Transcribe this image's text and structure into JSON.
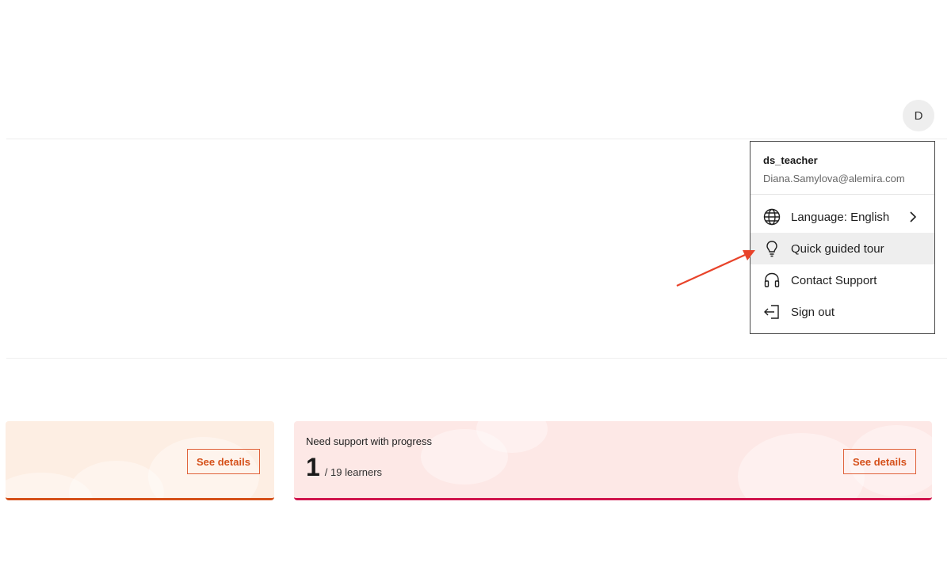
{
  "header": {
    "avatar_initial": "D"
  },
  "user_menu": {
    "username": "ds_teacher",
    "email": "Diana.Samylova@alemira.com",
    "items": [
      {
        "label": "Language: English",
        "icon": "globe-icon",
        "has_submenu": true
      },
      {
        "label": "Quick guided tour",
        "icon": "lightbulb-icon",
        "highlighted": true
      },
      {
        "label": "Contact Support",
        "icon": "headset-icon"
      },
      {
        "label": "Sign out",
        "icon": "sign-out-icon"
      }
    ]
  },
  "annotation": {
    "arrow_color": "#e8432a"
  },
  "cards": [
    {
      "button_label": "See details",
      "accent": "#d5501a"
    },
    {
      "title": "Need support with progress",
      "count": "1",
      "total": "/ 19 learners",
      "button_label": "See details",
      "accent": "#d0154d"
    }
  ]
}
